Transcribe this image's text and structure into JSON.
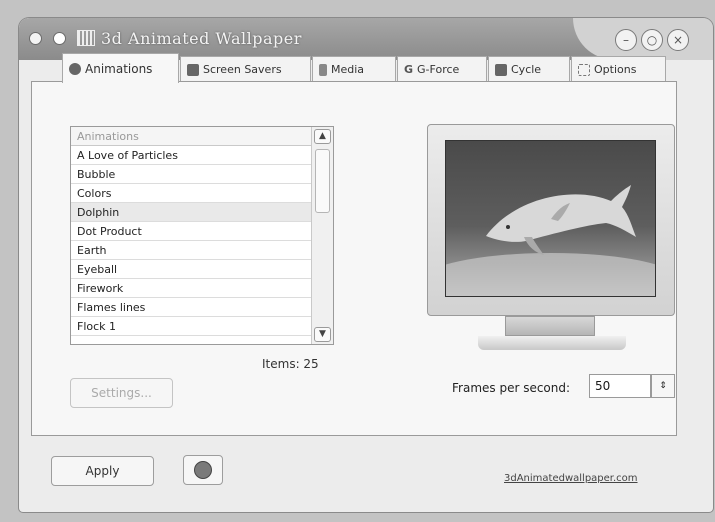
{
  "window": {
    "title": "3d Animated Wallpaper"
  },
  "tabs": [
    {
      "label": "Animations",
      "icon": "animations-icon"
    },
    {
      "label": "Screen Savers",
      "icon": "screen-savers-icon"
    },
    {
      "label": "Media",
      "icon": "media-icon"
    },
    {
      "label": "G-Force",
      "icon": "g-force-icon"
    },
    {
      "label": "Cycle",
      "icon": "cycle-icon"
    },
    {
      "label": "Options",
      "icon": "options-icon"
    }
  ],
  "animations": {
    "header": "Animations",
    "items": [
      "A Love of Particles",
      "Bubble",
      "Colors",
      "Dolphin",
      "Dot Product",
      "Earth",
      "Eyeball",
      "Firework",
      "Flames lines",
      "Flock 1"
    ],
    "selected": "Dolphin",
    "count_label": "Items: 25",
    "settings_label": "Settings..."
  },
  "preview": {
    "subject": "dolphin"
  },
  "fps": {
    "label": "Frames per second:",
    "value": "50"
  },
  "footer": {
    "apply_label": "Apply",
    "stop_label": "stop",
    "link_text": "3dAnimatedwallpaper.com"
  },
  "colors": {
    "window": "#ececec",
    "titlebar": "#8b8b8b",
    "background": "#c3c3c3"
  }
}
